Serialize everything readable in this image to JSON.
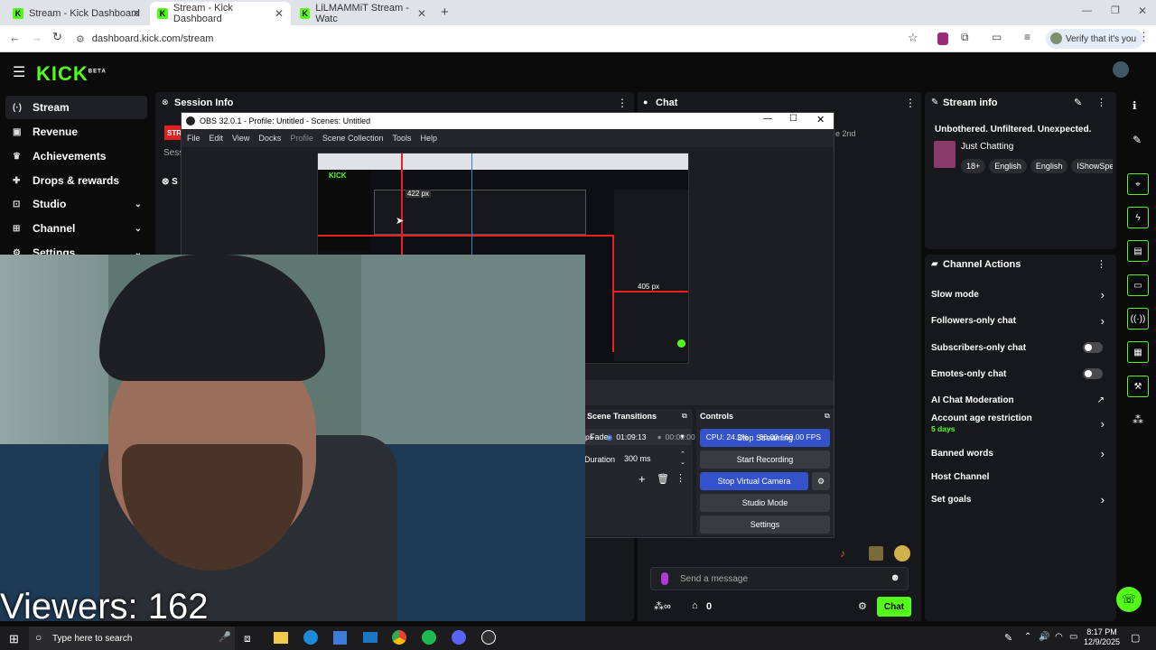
{
  "browser": {
    "tabs": [
      {
        "label": "Stream - Kick Dashboard",
        "active": false
      },
      {
        "label": "Stream - Kick Dashboard",
        "active": true
      },
      {
        "label": "LiLMAMMiT Stream - Watc",
        "active": false
      }
    ],
    "url": "dashboard.kick.com/stream",
    "verify_label": "Verify that it's you"
  },
  "kick": {
    "logo": "KICK",
    "logo_badge": "BETA",
    "accent": "#53fc18",
    "sidebar": [
      {
        "label": "Stream",
        "icon": "broadcast-icon",
        "expandable": false
      },
      {
        "label": "Revenue",
        "icon": "money-icon",
        "expandable": false
      },
      {
        "label": "Achievements",
        "icon": "trophy-icon",
        "expandable": false
      },
      {
        "label": "Drops & rewards",
        "icon": "gift-icon",
        "expandable": false
      },
      {
        "label": "Studio",
        "icon": "studio-icon",
        "expandable": true
      },
      {
        "label": "Channel",
        "icon": "channel-icon",
        "expandable": true
      },
      {
        "label": "Settings",
        "icon": "gear-icon",
        "expandable": true
      }
    ],
    "session_info": {
      "title": "Session Info",
      "partial_label": "Sess",
      "partial_s": "S",
      "red_badge": "STR"
    },
    "chat": {
      "title": "Chat",
      "partial_text": "e 2nd",
      "input_placeholder": "Send a message",
      "count": "0",
      "send_label": "Chat"
    },
    "stream_info": {
      "title": "Stream info",
      "stream_title": "Unbothered. Unfiltered. Unexpected.",
      "category": "Just Chatting",
      "tags": [
        "18+",
        "English",
        "English",
        "IShowSpe"
      ]
    },
    "channel_actions": {
      "title": "Channel Actions",
      "items": [
        {
          "label": "Slow mode",
          "control": "chevron"
        },
        {
          "label": "Followers-only chat",
          "control": "chevron"
        },
        {
          "label": "Subscribers-only chat",
          "control": "toggle"
        },
        {
          "label": "Emotes-only chat",
          "control": "toggle"
        },
        {
          "label": "AI Chat Moderation",
          "control": "external"
        },
        {
          "label": "Account age restriction",
          "control": "chevron",
          "sub": "5 days"
        },
        {
          "label": "Banned words",
          "control": "chevron"
        },
        {
          "label": "Host Channel",
          "control": "none"
        },
        {
          "label": "Set goals",
          "control": "chevron"
        }
      ]
    }
  },
  "obs": {
    "title": "OBS 32.0.1 - Profile: Untitled - Scenes: Untitled",
    "menu": [
      "File",
      "Edit",
      "View",
      "Docks",
      "Profile",
      "Scene Collection",
      "Tools",
      "Help"
    ],
    "preview_measure_1": "422 px",
    "preview_measure_2": "405 px",
    "scene_transitions": {
      "title": "Scene Transitions",
      "transition": "Fade",
      "duration_label": "Duration",
      "duration_value": "300 ms"
    },
    "controls": {
      "title": "Controls",
      "buttons": [
        "Stop Streaming",
        "Start Recording",
        "Stop Virtual Camera",
        "Studio Mode",
        "Settings"
      ]
    },
    "status": {
      "fps_partial": "ps",
      "stream_time": "01:09:13",
      "record_time": "00:00:00",
      "cpu": "CPU: 24.2%",
      "fps": "60.00 / 60.00 FPS"
    }
  },
  "webcam": {
    "viewers_overlay": "Viewers: 162"
  },
  "taskbar": {
    "search_placeholder": "Type here to search",
    "time": "8:17 PM",
    "date": "12/9/2025"
  }
}
